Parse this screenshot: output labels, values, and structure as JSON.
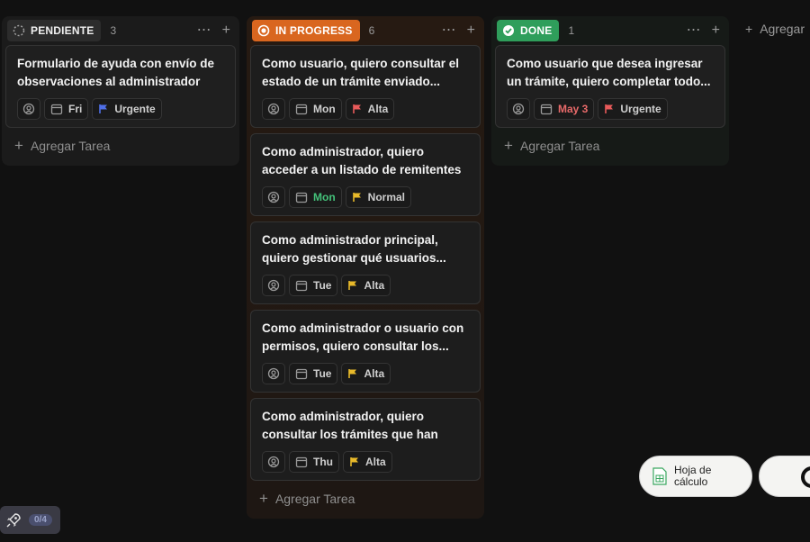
{
  "columns": {
    "pendiente": {
      "label": "PENDIENTE",
      "count": "3",
      "cards": [
        {
          "title": "Formulario de ayuda con envío de observaciones al administrador",
          "date": "Fri",
          "priority": "Urgente"
        }
      ],
      "add_label": "Agregar Tarea"
    },
    "in_progress": {
      "label": "IN PROGRESS",
      "count": "6",
      "cards": [
        {
          "title": "Como usuario, quiero consultar el estado de un trámite enviado...",
          "date": "Mon",
          "priority": "Alta"
        },
        {
          "title": "Como administrador, quiero acceder a un listado de remitentes que han...",
          "date": "Mon",
          "priority": "Normal"
        },
        {
          "title": "Como administrador principal, quiero gestionar qué usuarios...",
          "date": "Tue",
          "priority": "Alta"
        },
        {
          "title": "Como administrador o usuario con permisos, quiero consultar los...",
          "date": "Tue",
          "priority": "Alta"
        },
        {
          "title": "Como administrador, quiero consultar los trámites que han sid...",
          "date": "Thu",
          "priority": "Alta"
        }
      ],
      "add_label": "Agregar Tarea"
    },
    "done": {
      "label": "DONE",
      "count": "1",
      "cards": [
        {
          "title": "Como usuario que desea ingresar un trámite, quiero completar todo...",
          "date": "May 3",
          "priority": "Urgente"
        }
      ],
      "add_label": "Agregar Tarea"
    }
  },
  "add_group_label": "Agregar",
  "fab": {
    "sheet_label": "Hoja de cálculo"
  },
  "rocket": {
    "badge": "0/4"
  },
  "colors": {
    "pendiente": "#2c2c2c",
    "in_progress": "#d9661f",
    "done": "#2f9e5b",
    "flag_urgente": "#4f6fe8",
    "flag_alta": "#e85a5a",
    "flag_normal": "#e8b92a",
    "flag_alta_yellow": "#e8b92a"
  }
}
